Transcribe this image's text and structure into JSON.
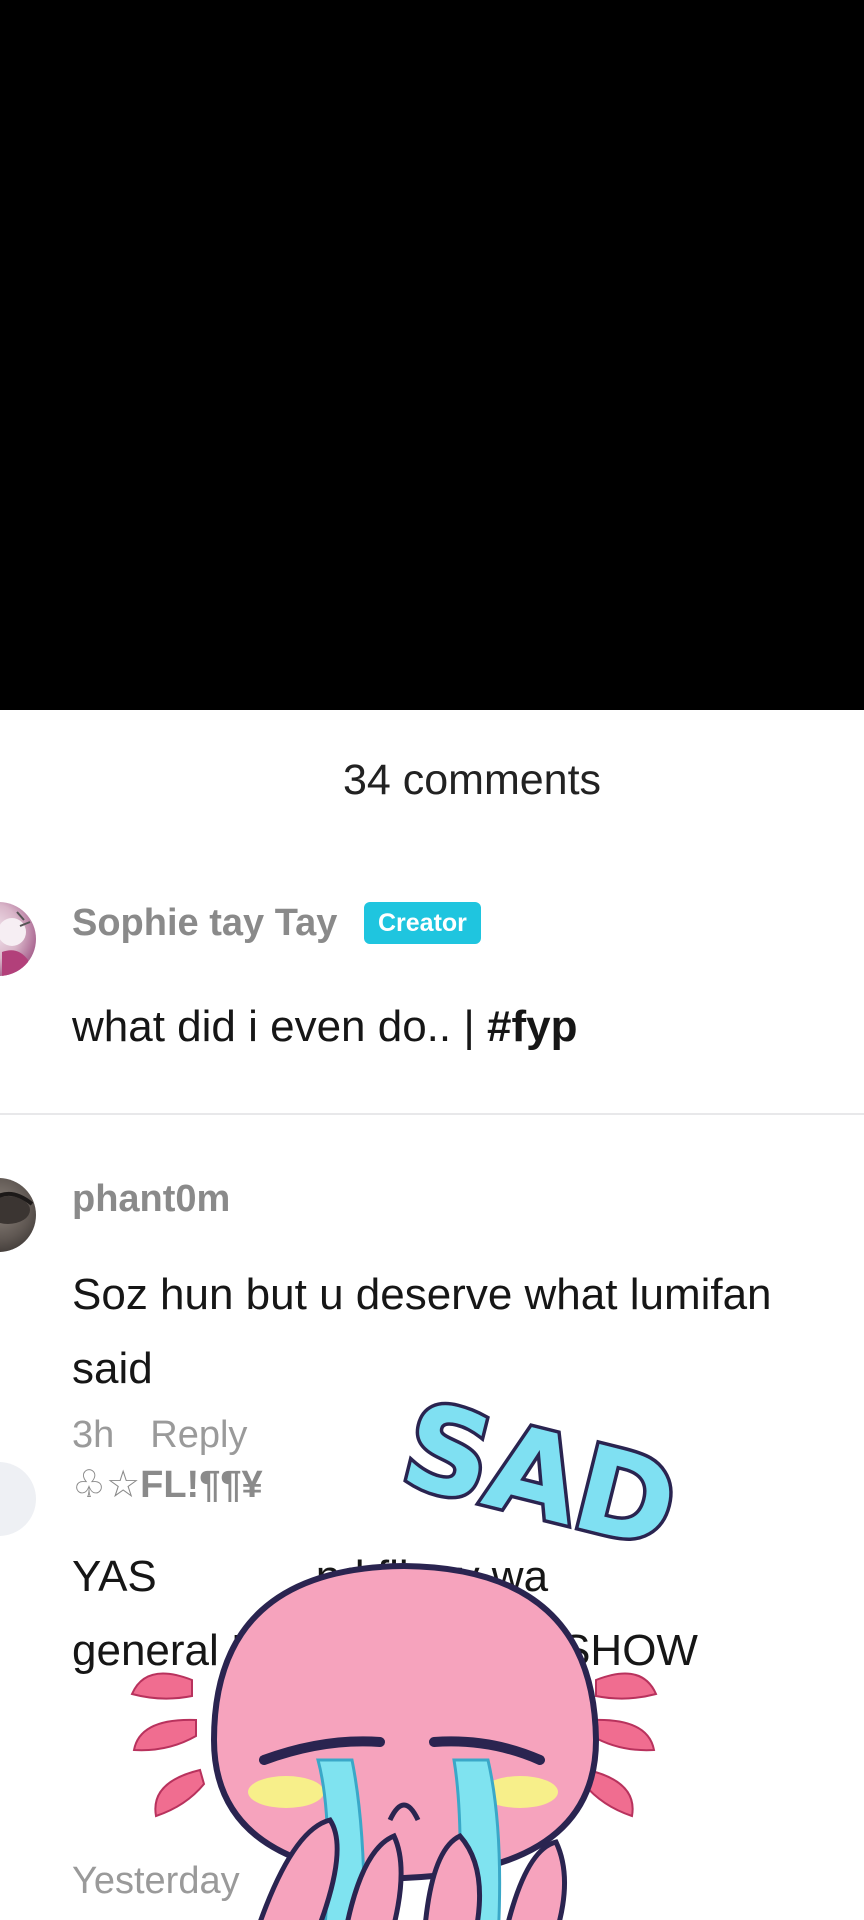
{
  "header": {
    "comment_count": "34 comments"
  },
  "comments": [
    {
      "author": "Sophie tay Tay",
      "badge": "Creator",
      "text": "what did i even do.. | ",
      "hashtag": "#fyp"
    },
    {
      "author": "phant0m",
      "text": "Soz hun but u deserve what lumifan said",
      "time": "3h",
      "reply_label": "Reply"
    },
    {
      "author": "♧☆FL!¶¶¥",
      "text": "YAS             nd flippy wa               general NOT IRL             SHOW",
      "time": "Yesterday"
    }
  ],
  "sticker": {
    "label": "SAD",
    "description_icon": "crying-axolotl-sticker"
  },
  "colors": {
    "badge": "#1fc5df",
    "sticker_pink": "#f5a3bf",
    "sticker_tear": "#7fe3f0",
    "sticker_text": "#6fd7ee"
  }
}
